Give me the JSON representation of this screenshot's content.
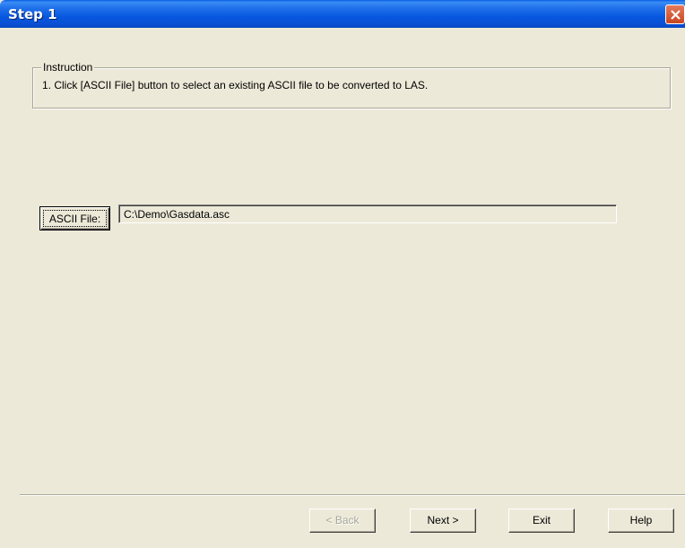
{
  "window": {
    "title": "Step 1"
  },
  "instruction": {
    "legend": "Instruction",
    "text": "1. Click [ASCII File] button to select an existing ASCII file to be converted to LAS."
  },
  "file": {
    "button_label": "ASCII File:",
    "path": "C:\\Demo\\Gasdata.asc"
  },
  "nav": {
    "back_label": "< Back",
    "next_label": "Next >",
    "exit_label": "Exit",
    "help_label": "Help"
  },
  "icons": {
    "close": "close-icon"
  },
  "colors": {
    "titlebar": "#0a5fe4",
    "close": "#c9461f",
    "dialog_bg": "#ece9d8"
  }
}
